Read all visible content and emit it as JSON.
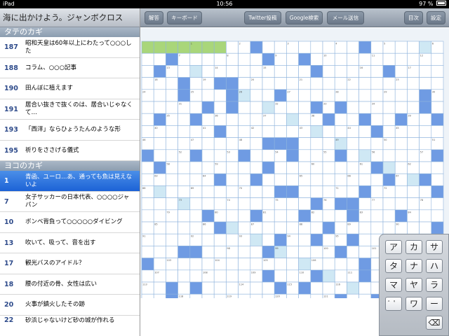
{
  "status": {
    "device": "iPad",
    "time": "10:56",
    "battery": "97 %"
  },
  "title": "海に出かけよう。ジャンボクロス",
  "sections": {
    "tate": "タテのカギ",
    "yoko": "ヨコのカギ"
  },
  "tate_clues": [
    {
      "num": "187",
      "text": "昭和天皇は60年以上にわたって○○○した"
    },
    {
      "num": "188",
      "text": "コラム、○○○記事"
    },
    {
      "num": "190",
      "text": "田んぼに植えます"
    },
    {
      "num": "191",
      "text": "居合い抜きで抜くのは、居合いじゃなくて…"
    },
    {
      "num": "193",
      "text": "「西洋」ならひょうたんのような形"
    },
    {
      "num": "195",
      "text": "祈りをささげる儀式"
    }
  ],
  "yoko_clues": [
    {
      "num": "1",
      "text": "青函、ユーロ…あ、通っても魚は見えないよ"
    },
    {
      "num": "7",
      "text": "女子サッカーの日本代表、○○○○ジャパン"
    },
    {
      "num": "10",
      "text": "ボンベ背負って○○○○○ダイビング"
    },
    {
      "num": "13",
      "text": "吹いて、吸って、音を出す"
    },
    {
      "num": "17",
      "text": "観光バスのアイドル？"
    },
    {
      "num": "18",
      "text": "腰の付近の骨、女性は広い"
    },
    {
      "num": "20",
      "text": "火事が鎮火したその跡"
    },
    {
      "num": "22",
      "text": "砂浜じゃないけど砂の城が作れる"
    }
  ],
  "toolbar": {
    "answer": "解答",
    "keyboard": "キーボード",
    "twitter": "Twitter投稿",
    "google": "Google検索",
    "mail": "メール送信",
    "index": "目次",
    "settings": "設定"
  },
  "keypad": {
    "keys": [
      "ア",
      "カ",
      "サ",
      "タ",
      "ナ",
      "ハ",
      "マ",
      "ヤ",
      "ラ",
      "゛゜",
      "ワ",
      "ー"
    ],
    "delete": "⌫"
  },
  "colors": {
    "block": "#6f9be3",
    "hint": "#cfe8f4",
    "highlight": "#a9d67a",
    "gridline": "#8fb3dd"
  },
  "grid": {
    "cols": 25,
    "rows": 22,
    "highlighted_row": 0,
    "highlighted_cols": [
      0,
      1,
      2,
      3,
      4,
      5,
      6
    ]
  }
}
